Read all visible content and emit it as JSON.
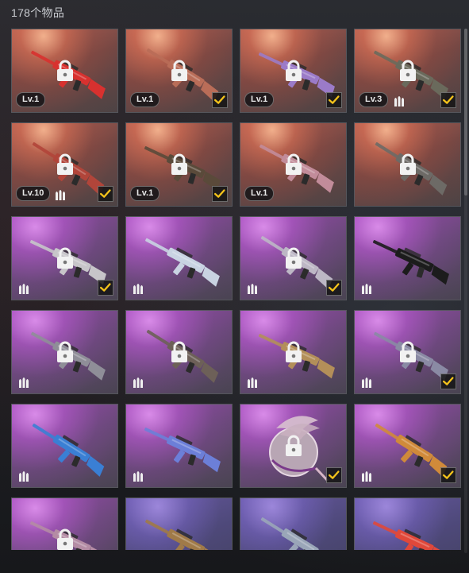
{
  "header": {
    "item_count": "178个物品"
  },
  "colors": {
    "check": "#f3c31b",
    "lock": "#f2f2f2"
  },
  "items": [
    {
      "rarity": "gold",
      "weapon": "red-white-rifle",
      "weapon_color": "#d8312f",
      "locked": true,
      "level": "Lv.1",
      "ammo": false,
      "selected": false
    },
    {
      "rarity": "gold",
      "weapon": "ornate-rifle",
      "weapon_color": "#b96d58",
      "locked": true,
      "level": "Lv.1",
      "ammo": false,
      "selected": true
    },
    {
      "rarity": "gold",
      "weapon": "purple-rifle",
      "weapon_color": "#9b7bc8",
      "locked": true,
      "level": "Lv.1",
      "ammo": false,
      "selected": true
    },
    {
      "rarity": "gold",
      "weapon": "camo-rifle",
      "weapon_color": "#6a6a5c",
      "locked": true,
      "level": "Lv.3",
      "ammo": true,
      "selected": true
    },
    {
      "rarity": "gold",
      "weapon": "red-ornate-rifle",
      "weapon_color": "#b1453a",
      "locked": true,
      "level": "Lv.10",
      "ammo": true,
      "selected": true
    },
    {
      "rarity": "gold",
      "weapon": "dark-rifle",
      "weapon_color": "#5a4a3a",
      "locked": true,
      "level": "Lv.1",
      "ammo": false,
      "selected": true
    },
    {
      "rarity": "gold",
      "weapon": "pink-rifle",
      "weapon_color": "#c28c9a",
      "locked": true,
      "level": "Lv.1",
      "ammo": false,
      "selected": false
    },
    {
      "rarity": "gold",
      "weapon": "grey-rifle",
      "weapon_color": "#6d6a66",
      "locked": true,
      "level": "",
      "ammo": false,
      "selected": false
    },
    {
      "rarity": "purple",
      "weapon": "silver-rifle",
      "weapon_color": "#c7c5c9",
      "locked": true,
      "level": "",
      "ammo": true,
      "selected": true
    },
    {
      "rarity": "purple",
      "weapon": "snow-camo-rifle",
      "weapon_color": "#c9d3e2",
      "locked": false,
      "level": "",
      "ammo": true,
      "selected": false
    },
    {
      "rarity": "purple",
      "weapon": "chrome-rifle",
      "weapon_color": "#bdb7c5",
      "locked": true,
      "level": "",
      "ammo": true,
      "selected": true
    },
    {
      "rarity": "purple",
      "weapon": "black-gold-rifle",
      "weapon_color": "#1c1c1c",
      "locked": false,
      "level": "",
      "ammo": true,
      "selected": false
    },
    {
      "rarity": "purple",
      "weapon": "grey-m4",
      "weapon_color": "#8f8e98",
      "locked": true,
      "level": "",
      "ammo": true,
      "selected": false
    },
    {
      "rarity": "purple",
      "weapon": "brown-m4",
      "weapon_color": "#6d6058",
      "locked": true,
      "level": "",
      "ammo": true,
      "selected": false
    },
    {
      "rarity": "purple",
      "weapon": "gold-pattern-m4",
      "weapon_color": "#b38f59",
      "locked": true,
      "level": "",
      "ammo": true,
      "selected": false
    },
    {
      "rarity": "purple",
      "weapon": "floral-m4",
      "weapon_color": "#8a8aa4",
      "locked": true,
      "level": "",
      "ammo": true,
      "selected": true
    },
    {
      "rarity": "purple",
      "weapon": "blue-graffiti-rifle",
      "weapon_color": "#3a7fd4",
      "locked": false,
      "level": "",
      "ammo": true,
      "selected": false
    },
    {
      "rarity": "purple",
      "weapon": "blue-purple-ak",
      "weapon_color": "#6c7fd8",
      "locked": false,
      "level": "",
      "ammo": true,
      "selected": false
    },
    {
      "rarity": "purple",
      "weapon": "wing-emblem",
      "weapon_color": "#d7b7c8",
      "locked": true,
      "level": "",
      "ammo": false,
      "selected": true
    },
    {
      "rarity": "purple",
      "weapon": "gold-orange-rifle",
      "weapon_color": "#d08a3a",
      "locked": false,
      "level": "",
      "ammo": true,
      "selected": true
    },
    {
      "rarity": "purple",
      "weapon": "pink-rifle-2",
      "weapon_color": "#b48ca4",
      "locked": true,
      "level": "",
      "ammo": false,
      "selected": false
    },
    {
      "rarity": "violet",
      "weapon": "tan-smg",
      "weapon_color": "#a07a48",
      "locked": false,
      "level": "",
      "ammo": false,
      "selected": false
    },
    {
      "rarity": "violet",
      "weapon": "steel-rifle",
      "weapon_color": "#9aa6b8",
      "locked": false,
      "level": "",
      "ammo": false,
      "selected": false
    },
    {
      "rarity": "violet",
      "weapon": "neon-smg",
      "weapon_color": "#e0483a",
      "locked": false,
      "level": "",
      "ammo": false,
      "selected": false
    }
  ]
}
